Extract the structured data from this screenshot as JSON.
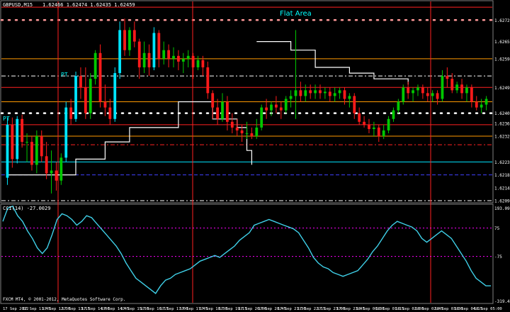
{
  "window": {
    "symbol_label": "GBPUSD,M15",
    "ohlc_label": "1.62466 1.62474 1.62435 1.62459",
    "annotation": "Flat Area",
    "pt_labels": [
      "PT",
      "PT"
    ],
    "indicator_label": "CCI(14) -27.0029",
    "copyright": "FXCM MT4, © 2001-2012, MetaQuotes Software Corp."
  },
  "colors": {
    "background": "#000000",
    "bull": "#00c800",
    "bull_strong": "#00e5ff",
    "bear": "#ff1a1a",
    "grid_red": "#ff2020",
    "orange": "#ff9900",
    "white": "#ffffff",
    "magenta": "#ff00ff",
    "blue_dash": "#4040ff",
    "cci": "#3fd0e8",
    "annotation": "#00ffff"
  },
  "chart_data": [
    {
      "type": "candlestick",
      "title": "GBPUSD,M15",
      "y_axis_ticks": [
        "1.62725",
        "1.62650",
        "1.62590",
        "1.62490",
        "1.62400",
        "1.62365",
        "1.62320",
        "1.62230",
        "1.62185",
        "1.62140",
        "1.62095"
      ],
      "ylim": [
        1.6209,
        1.6279
      ],
      "x_axis_ticks": [
        "17 Sep 2012",
        "17 Sep 11:45",
        "17 Sep 12:30",
        "17 Sep 13:15",
        "17 Sep 14:00",
        "17 Sep 14:45",
        "17 Sep 15:30",
        "17 Sep 16:15",
        "17 Sep 17:00",
        "17 Sep 17:45",
        "17 Sep 18:30",
        "17 Sep 19:15",
        "17 Sep 20:00",
        "17 Sep 20:45",
        "17 Sep 21:30",
        "17 Sep 22:15",
        "17 Sep 23:00",
        "17 Sep 23:45",
        "18 Sep 00:30",
        "18 Sep 01:15",
        "18 Sep 02:00",
        "18 Sep 02:45",
        "18 Sep 03:30",
        "18 Sep 04:15",
        "18 Sep 05:00"
      ],
      "candles": [
        {
          "o": 1.62175,
          "h": 1.62385,
          "l": 1.6215,
          "c": 1.6236
        },
        {
          "o": 1.6236,
          "h": 1.62385,
          "l": 1.6221,
          "c": 1.6224
        },
        {
          "o": 1.6224,
          "h": 1.6239,
          "l": 1.62225,
          "c": 1.6238
        },
        {
          "o": 1.6238,
          "h": 1.62395,
          "l": 1.6228,
          "c": 1.623
        },
        {
          "o": 1.623,
          "h": 1.6233,
          "l": 1.6223,
          "c": 1.623
        },
        {
          "o": 1.623,
          "h": 1.6232,
          "l": 1.622,
          "c": 1.6222
        },
        {
          "o": 1.6222,
          "h": 1.6234,
          "l": 1.6219,
          "c": 1.6232
        },
        {
          "o": 1.6232,
          "h": 1.6234,
          "l": 1.6223,
          "c": 1.6225
        },
        {
          "o": 1.6225,
          "h": 1.623,
          "l": 1.6217,
          "c": 1.6219
        },
        {
          "o": 1.6219,
          "h": 1.6227,
          "l": 1.6212,
          "c": 1.622
        },
        {
          "o": 1.622,
          "h": 1.6223,
          "l": 1.6213,
          "c": 1.62165
        },
        {
          "o": 1.62165,
          "h": 1.6226,
          "l": 1.6215,
          "c": 1.62245
        },
        {
          "o": 1.62245,
          "h": 1.6244,
          "l": 1.6223,
          "c": 1.6242
        },
        {
          "o": 1.6242,
          "h": 1.6245,
          "l": 1.6236,
          "c": 1.6238
        },
        {
          "o": 1.6238,
          "h": 1.62545,
          "l": 1.6237,
          "c": 1.6253
        },
        {
          "o": 1.6253,
          "h": 1.6256,
          "l": 1.6245,
          "c": 1.6249
        },
        {
          "o": 1.6249,
          "h": 1.6256,
          "l": 1.6238,
          "c": 1.624
        },
        {
          "o": 1.624,
          "h": 1.6254,
          "l": 1.6238,
          "c": 1.6252
        },
        {
          "o": 1.6252,
          "h": 1.6262,
          "l": 1.625,
          "c": 1.6261
        },
        {
          "o": 1.6261,
          "h": 1.6264,
          "l": 1.6242,
          "c": 1.6244
        },
        {
          "o": 1.6244,
          "h": 1.625,
          "l": 1.6239,
          "c": 1.6242
        },
        {
          "o": 1.6242,
          "h": 1.6245,
          "l": 1.6236,
          "c": 1.6238
        },
        {
          "o": 1.6238,
          "h": 1.6256,
          "l": 1.6237,
          "c": 1.6254
        },
        {
          "o": 1.6254,
          "h": 1.6272,
          "l": 1.6252,
          "c": 1.6269
        },
        {
          "o": 1.6269,
          "h": 1.6273,
          "l": 1.626,
          "c": 1.6262
        },
        {
          "o": 1.6262,
          "h": 1.627,
          "l": 1.626,
          "c": 1.6269
        },
        {
          "o": 1.6269,
          "h": 1.6272,
          "l": 1.6263,
          "c": 1.6265
        },
        {
          "o": 1.6265,
          "h": 1.6266,
          "l": 1.6252,
          "c": 1.6256
        },
        {
          "o": 1.6256,
          "h": 1.6265,
          "l": 1.6254,
          "c": 1.6261
        },
        {
          "o": 1.6261,
          "h": 1.6264,
          "l": 1.6253,
          "c": 1.6256
        },
        {
          "o": 1.6256,
          "h": 1.627,
          "l": 1.6255,
          "c": 1.6268
        },
        {
          "o": 1.6268,
          "h": 1.6269,
          "l": 1.6256,
          "c": 1.6259
        },
        {
          "o": 1.6259,
          "h": 1.6265,
          "l": 1.6257,
          "c": 1.6262
        },
        {
          "o": 1.6262,
          "h": 1.6264,
          "l": 1.6256,
          "c": 1.6259
        },
        {
          "o": 1.6259,
          "h": 1.6263,
          "l": 1.6256,
          "c": 1.626
        },
        {
          "o": 1.626,
          "h": 1.6262,
          "l": 1.6255,
          "c": 1.6258
        },
        {
          "o": 1.6258,
          "h": 1.6261,
          "l": 1.6254,
          "c": 1.6259
        },
        {
          "o": 1.6259,
          "h": 1.6262,
          "l": 1.6256,
          "c": 1.626
        },
        {
          "o": 1.626,
          "h": 1.6261,
          "l": 1.6252,
          "c": 1.6256
        },
        {
          "o": 1.6256,
          "h": 1.626,
          "l": 1.6255,
          "c": 1.62585
        },
        {
          "o": 1.62585,
          "h": 1.626,
          "l": 1.6253,
          "c": 1.6256
        },
        {
          "o": 1.6256,
          "h": 1.6258,
          "l": 1.6245,
          "c": 1.6247
        },
        {
          "o": 1.6247,
          "h": 1.6248,
          "l": 1.6238,
          "c": 1.6242
        },
        {
          "o": 1.6242,
          "h": 1.6245,
          "l": 1.6236,
          "c": 1.6238
        },
        {
          "o": 1.6238,
          "h": 1.6247,
          "l": 1.6237,
          "c": 1.6244
        },
        {
          "o": 1.6244,
          "h": 1.6246,
          "l": 1.6234,
          "c": 1.6237
        },
        {
          "o": 1.6237,
          "h": 1.624,
          "l": 1.6233,
          "c": 1.6235
        },
        {
          "o": 1.6235,
          "h": 1.6238,
          "l": 1.6232,
          "c": 1.6234
        },
        {
          "o": 1.6234,
          "h": 1.6236,
          "l": 1.623,
          "c": 1.6233
        },
        {
          "o": 1.6233,
          "h": 1.6237,
          "l": 1.6231,
          "c": 1.6233
        },
        {
          "o": 1.6233,
          "h": 1.6235,
          "l": 1.6231,
          "c": 1.6232
        },
        {
          "o": 1.6232,
          "h": 1.6238,
          "l": 1.6231,
          "c": 1.6235
        },
        {
          "o": 1.6235,
          "h": 1.6243,
          "l": 1.6234,
          "c": 1.6242
        },
        {
          "o": 1.6242,
          "h": 1.6245,
          "l": 1.6238,
          "c": 1.6241
        },
        {
          "o": 1.6241,
          "h": 1.6244,
          "l": 1.6239,
          "c": 1.6243
        },
        {
          "o": 1.6243,
          "h": 1.6246,
          "l": 1.624,
          "c": 1.6242
        },
        {
          "o": 1.6242,
          "h": 1.6244,
          "l": 1.6238,
          "c": 1.6241
        },
        {
          "o": 1.6241,
          "h": 1.6246,
          "l": 1.624,
          "c": 1.6245
        },
        {
          "o": 1.6245,
          "h": 1.6248,
          "l": 1.6242,
          "c": 1.6246
        },
        {
          "o": 1.6246,
          "h": 1.6269,
          "l": 1.6238,
          "c": 1.6248
        },
        {
          "o": 1.6248,
          "h": 1.6251,
          "l": 1.6244,
          "c": 1.6246
        },
        {
          "o": 1.6246,
          "h": 1.625,
          "l": 1.6244,
          "c": 1.6248
        },
        {
          "o": 1.6248,
          "h": 1.625,
          "l": 1.6245,
          "c": 1.6247
        },
        {
          "o": 1.6247,
          "h": 1.625,
          "l": 1.6245,
          "c": 1.6248
        },
        {
          "o": 1.6248,
          "h": 1.625,
          "l": 1.6245,
          "c": 1.6247
        },
        {
          "o": 1.6247,
          "h": 1.6249,
          "l": 1.6245,
          "c": 1.62475
        },
        {
          "o": 1.62475,
          "h": 1.6249,
          "l": 1.6244,
          "c": 1.6246
        },
        {
          "o": 1.6246,
          "h": 1.6249,
          "l": 1.6244,
          "c": 1.6247
        },
        {
          "o": 1.6247,
          "h": 1.6249,
          "l": 1.6245,
          "c": 1.6248
        },
        {
          "o": 1.6248,
          "h": 1.6249,
          "l": 1.6243,
          "c": 1.6245
        },
        {
          "o": 1.6245,
          "h": 1.6247,
          "l": 1.6242,
          "c": 1.6246
        },
        {
          "o": 1.6246,
          "h": 1.6247,
          "l": 1.6238,
          "c": 1.624
        },
        {
          "o": 1.624,
          "h": 1.6242,
          "l": 1.6236,
          "c": 1.6237
        },
        {
          "o": 1.6237,
          "h": 1.6239,
          "l": 1.6235,
          "c": 1.6236
        },
        {
          "o": 1.6236,
          "h": 1.6238,
          "l": 1.6233,
          "c": 1.62345
        },
        {
          "o": 1.62345,
          "h": 1.6237,
          "l": 1.6232,
          "c": 1.6235
        },
        {
          "o": 1.6235,
          "h": 1.6236,
          "l": 1.623,
          "c": 1.6232
        },
        {
          "o": 1.6232,
          "h": 1.6236,
          "l": 1.6231,
          "c": 1.6234
        },
        {
          "o": 1.6234,
          "h": 1.6239,
          "l": 1.6233,
          "c": 1.6238
        },
        {
          "o": 1.6238,
          "h": 1.6242,
          "l": 1.6237,
          "c": 1.6241
        },
        {
          "o": 1.6241,
          "h": 1.6245,
          "l": 1.624,
          "c": 1.6244
        },
        {
          "o": 1.6244,
          "h": 1.625,
          "l": 1.6243,
          "c": 1.6249
        },
        {
          "o": 1.6249,
          "h": 1.6251,
          "l": 1.6245,
          "c": 1.6247
        },
        {
          "o": 1.6247,
          "h": 1.6249,
          "l": 1.6244,
          "c": 1.6248
        },
        {
          "o": 1.6248,
          "h": 1.625,
          "l": 1.6246,
          "c": 1.6249
        },
        {
          "o": 1.6249,
          "h": 1.625,
          "l": 1.6245,
          "c": 1.6247
        },
        {
          "o": 1.6247,
          "h": 1.6249,
          "l": 1.6244,
          "c": 1.6246
        },
        {
          "o": 1.6246,
          "h": 1.6248,
          "l": 1.6244,
          "c": 1.6247
        },
        {
          "o": 1.6247,
          "h": 1.6248,
          "l": 1.6243,
          "c": 1.6245
        },
        {
          "o": 1.6245,
          "h": 1.6255,
          "l": 1.6244,
          "c": 1.6253
        },
        {
          "o": 1.6253,
          "h": 1.6256,
          "l": 1.6249,
          "c": 1.6252
        },
        {
          "o": 1.6252,
          "h": 1.6254,
          "l": 1.6247,
          "c": 1.6248
        },
        {
          "o": 1.6248,
          "h": 1.6251,
          "l": 1.6247,
          "c": 1.625
        },
        {
          "o": 1.625,
          "h": 1.6252,
          "l": 1.6245,
          "c": 1.6247
        },
        {
          "o": 1.6247,
          "h": 1.625,
          "l": 1.6244,
          "c": 1.6249
        },
        {
          "o": 1.6249,
          "h": 1.625,
          "l": 1.6242,
          "c": 1.6244
        },
        {
          "o": 1.6244,
          "h": 1.6246,
          "l": 1.6241,
          "c": 1.6242
        },
        {
          "o": 1.6242,
          "h": 1.6245,
          "l": 1.624,
          "c": 1.6243
        },
        {
          "o": 1.6243,
          "h": 1.6246,
          "l": 1.6241,
          "c": 1.6245
        }
      ],
      "horizontal_levels": [
        {
          "value": 1.6277,
          "color": "#ff2020",
          "style": "solid"
        },
        {
          "value": 1.62725,
          "color": "#ff9999",
          "style": "dots"
        },
        {
          "value": 1.6259,
          "color": "#ff9900",
          "style": "solid"
        },
        {
          "value": 1.6253,
          "color": "#ffffff",
          "style": "dashdot"
        },
        {
          "value": 1.6249,
          "color": "#ff2020",
          "style": "solid"
        },
        {
          "value": 1.6244,
          "color": "#ff9900",
          "style": "solid"
        },
        {
          "value": 1.624,
          "color": "#ffffff",
          "style": "dots"
        },
        {
          "value": 1.6236,
          "color": "#ff2020",
          "style": "solid"
        },
        {
          "value": 1.6232,
          "color": "#ff9900",
          "style": "solid"
        },
        {
          "value": 1.6229,
          "color": "#ff2020",
          "style": "dashdot"
        },
        {
          "value": 1.6223,
          "color": "#00e5ff",
          "style": "solid"
        },
        {
          "value": 1.62185,
          "color": "#4040ff",
          "style": "dash"
        },
        {
          "value": 1.62095,
          "color": "#ffffff",
          "style": "dashdot"
        }
      ],
      "step_lines": [
        {
          "color": "#ffffff",
          "points": [
            [
              0,
              1.62185
            ],
            [
              12,
              1.62185
            ],
            [
              14,
              1.6224
            ],
            [
              20,
              1.623
            ],
            [
              25,
              1.6235
            ],
            [
              35,
              1.6244
            ],
            [
              40,
              1.6244
            ],
            [
              42,
              1.6238
            ],
            [
              47,
              1.6235
            ],
            [
              49,
              1.6227
            ],
            [
              50,
              1.6222
            ]
          ]
        },
        {
          "color": "#ffffff",
          "points": [
            [
              51,
              1.6265
            ],
            [
              58,
              1.6262
            ],
            [
              63,
              1.6256
            ],
            [
              70,
              1.6254
            ],
            [
              75,
              1.6252
            ],
            [
              82,
              1.625
            ]
          ]
        }
      ]
    },
    {
      "type": "line",
      "title": "CCI(14) -27.0029",
      "y_axis_ticks": [
        "193.096",
        "75",
        "-75",
        "-319.47"
      ],
      "ylim": [
        -319.47,
        193.096
      ],
      "levels": [
        75,
        -75
      ],
      "values": [
        110,
        180,
        190,
        140,
        110,
        60,
        20,
        -30,
        -60,
        -30,
        40,
        120,
        150,
        140,
        120,
        90,
        110,
        140,
        130,
        100,
        70,
        40,
        10,
        -20,
        -60,
        -110,
        -150,
        -190,
        -210,
        -230,
        -250,
        -270,
        -230,
        -200,
        -190,
        -170,
        -160,
        -150,
        -140,
        -120,
        -100,
        -90,
        -80,
        -70,
        -80,
        -60,
        -40,
        -20,
        10,
        30,
        50,
        90,
        100,
        110,
        120,
        110,
        100,
        90,
        80,
        70,
        50,
        10,
        -30,
        -80,
        -110,
        -130,
        -140,
        -160,
        -170,
        -180,
        -170,
        -160,
        -150,
        -120,
        -90,
        -50,
        -20,
        20,
        60,
        90,
        110,
        100,
        90,
        80,
        60,
        20,
        0,
        20,
        40,
        60,
        40,
        20,
        -20,
        -60,
        -100,
        -150,
        -190,
        -210,
        -230,
        -230
      ]
    }
  ]
}
